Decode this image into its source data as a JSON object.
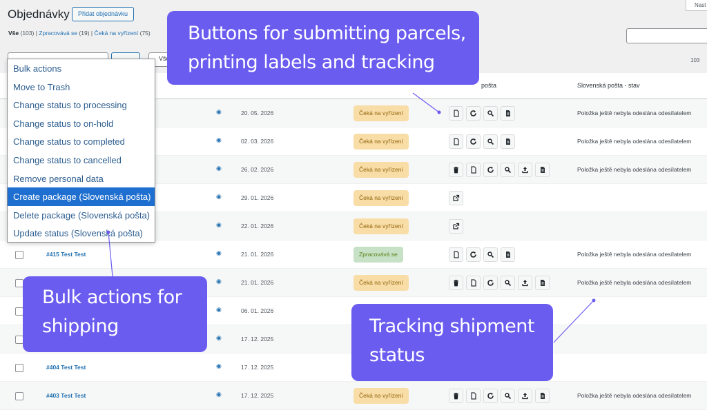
{
  "header": {
    "title": "Objednávky",
    "add_button": "Přidat objednávku",
    "screen_options": "Nast"
  },
  "filters": {
    "all": "Vše",
    "all_count": "(103)",
    "processing": "Zpracovává se",
    "processing_count": "(19)",
    "onhold": "Čeká na vyřízení",
    "onhold_count": "(75)",
    "filter_label": "Všec"
  },
  "pagination": {
    "items": "103"
  },
  "columns": {
    "slovak_post": "pošta",
    "slovak_post_status": "Slovenská pošta - stav"
  },
  "bulk_actions": {
    "items": [
      {
        "label": "Bulk actions",
        "selected": false
      },
      {
        "label": "Move to Trash",
        "selected": false
      },
      {
        "label": "Change status to processing",
        "selected": false
      },
      {
        "label": "Change status to on-hold",
        "selected": false
      },
      {
        "label": "Change status to completed",
        "selected": false
      },
      {
        "label": "Change status to cancelled",
        "selected": false
      },
      {
        "label": "Remove personal data",
        "selected": false
      },
      {
        "label": "Create package (Slovenská pošta)",
        "selected": true
      },
      {
        "label": "Delete package (Slovenská pošta)",
        "selected": false
      },
      {
        "label": "Update status (Slovenská pošta)",
        "selected": false
      }
    ]
  },
  "orders": [
    {
      "order": "",
      "date": "20. 05. 2026",
      "status": "Čeká na vyřízení",
      "status_type": "on-hold",
      "actions": [
        "document-icon",
        "refresh-icon",
        "search-icon",
        "file-text-icon"
      ],
      "sp_status": "Položka ještě nebyla odeslána odesílatelem"
    },
    {
      "order": "",
      "date": "02. 03. 2026",
      "status": "Čeká na vyřízení",
      "status_type": "on-hold",
      "actions": [
        "document-icon",
        "refresh-icon",
        "search-icon",
        "file-text-icon"
      ],
      "sp_status": "Položka ještě nebyla odeslána odesílatelem"
    },
    {
      "order": "",
      "date": "26. 02. 2026",
      "status": "Čeká na vyřízení",
      "status_type": "on-hold",
      "actions": [
        "trash-icon",
        "document-icon",
        "refresh-icon",
        "search-icon",
        "upload-icon",
        "file-text-icon"
      ],
      "sp_status": "Položka ještě nebyla odeslána odesílatelem"
    },
    {
      "order": "",
      "date": "29. 01. 2026",
      "status": "Čeká na vyřízení",
      "status_type": "on-hold",
      "actions": [
        "external-link-icon"
      ],
      "sp_status": ""
    },
    {
      "order": "",
      "date": "22. 01. 2026",
      "status": "Čeká na vyřízení",
      "status_type": "on-hold",
      "actions": [
        "external-link-icon"
      ],
      "sp_status": ""
    },
    {
      "order": "#415 Test Test",
      "date": "21. 01. 2026",
      "status": "Zpracovává se",
      "status_type": "processing",
      "actions": [
        "document-icon",
        "refresh-icon",
        "search-icon",
        "file-text-icon"
      ],
      "sp_status": "Položka ještě nebyla odeslána odesílatelem"
    },
    {
      "order": "",
      "date": "21. 01. 2026",
      "status": "Čeká na vyřízení",
      "status_type": "on-hold",
      "actions": [
        "trash-icon",
        "document-icon",
        "refresh-icon",
        "search-icon",
        "upload-icon",
        "file-text-icon"
      ],
      "sp_status": "Položka ještě nebyla odeslána odesílatelem"
    },
    {
      "order": "",
      "date": "06. 01. 2026",
      "status": "",
      "status_type": "",
      "actions": [],
      "sp_status": ""
    },
    {
      "order": "",
      "date": "17. 12. 2025",
      "status": "",
      "status_type": "",
      "actions": [],
      "sp_status": ""
    },
    {
      "order": "#404 Test Test",
      "date": "17. 12. 2025",
      "status": "",
      "status_type": "",
      "actions": [],
      "sp_status": ""
    },
    {
      "order": "#403 Test Test",
      "date": "17. 12. 2025",
      "status": "Čeká na vyřízení",
      "status_type": "on-hold",
      "actions": [
        "trash-icon",
        "document-icon",
        "refresh-icon",
        "search-icon",
        "upload-icon",
        "file-text-icon"
      ],
      "sp_status": "Položka ještě nebyla odeslána odesílatelem"
    }
  ],
  "callouts": {
    "buttons_line1": "Buttons for submitting parcels,",
    "buttons_line2": "printing labels and tracking",
    "bulk_line1": "Bulk actions for",
    "bulk_line2": "shipping",
    "tracking_line1": "Tracking shipment",
    "tracking_line2": "status"
  },
  "colors": {
    "accent": "#2271b1",
    "callout": "#6b5cf0",
    "onhold_bg": "#f8dda7",
    "processing_bg": "#c6e1c6",
    "selected_item": "#1e6fd0"
  }
}
